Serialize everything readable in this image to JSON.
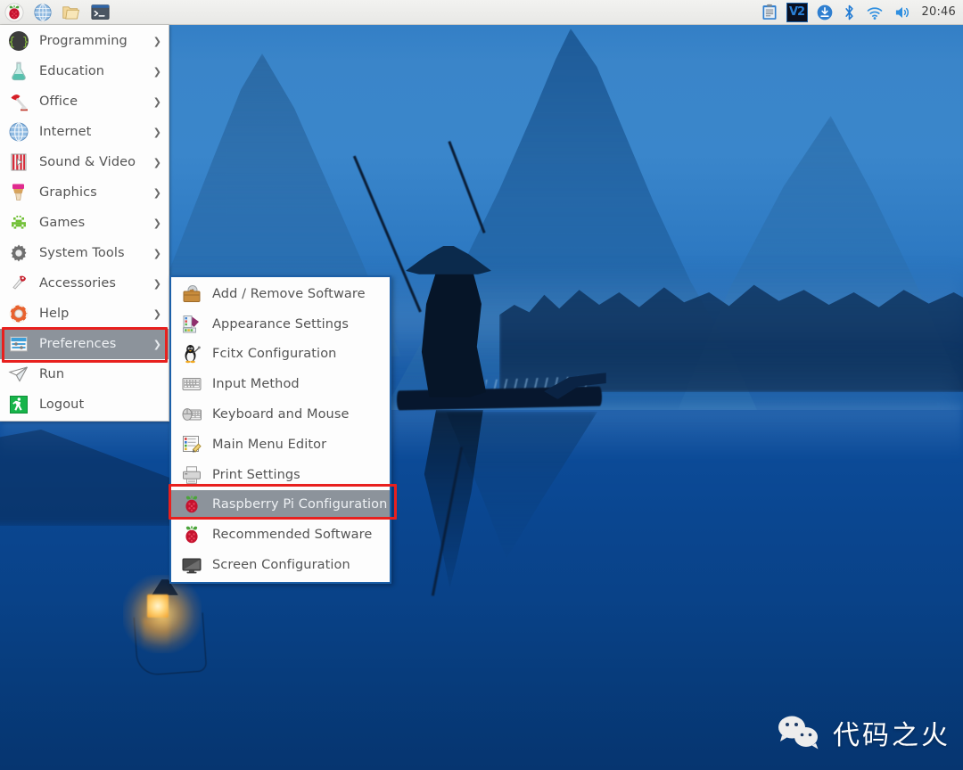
{
  "taskbar": {
    "launchers": [
      {
        "name": "raspberry-menu-icon",
        "label": "Menu"
      },
      {
        "name": "web-browser-icon",
        "label": "Web Browser"
      },
      {
        "name": "file-manager-icon",
        "label": "File Manager"
      },
      {
        "name": "terminal-icon",
        "label": "Terminal"
      }
    ],
    "tray": [
      {
        "name": "clipboard-icon",
        "label": "Clipboard"
      },
      {
        "name": "v2ray-icon",
        "label": "V2"
      },
      {
        "name": "updater-icon",
        "label": "Updates"
      },
      {
        "name": "bluetooth-icon",
        "label": "Bluetooth"
      },
      {
        "name": "wifi-icon",
        "label": "Wireless Network"
      },
      {
        "name": "volume-icon",
        "label": "Volume"
      }
    ],
    "clock": "20:46"
  },
  "main_menu": {
    "items": [
      {
        "label": "Programming",
        "icon": "braces-icon",
        "has_arrow": true,
        "selected": false
      },
      {
        "label": "Education",
        "icon": "flask-icon",
        "has_arrow": true,
        "selected": false
      },
      {
        "label": "Office",
        "icon": "desk-lamp-icon",
        "has_arrow": true,
        "selected": false
      },
      {
        "label": "Internet",
        "icon": "globe-icon",
        "has_arrow": true,
        "selected": false
      },
      {
        "label": "Sound & Video",
        "icon": "film-icon",
        "has_arrow": true,
        "selected": false
      },
      {
        "label": "Graphics",
        "icon": "paintbrush-icon",
        "has_arrow": true,
        "selected": false
      },
      {
        "label": "Games",
        "icon": "space-invader-icon",
        "has_arrow": true,
        "selected": false
      },
      {
        "label": "System Tools",
        "icon": "gear-icon",
        "has_arrow": true,
        "selected": false
      },
      {
        "label": "Accessories",
        "icon": "swiss-knife-icon",
        "has_arrow": true,
        "selected": false
      },
      {
        "label": "Help",
        "icon": "lifebuoy-icon",
        "has_arrow": true,
        "selected": false
      },
      {
        "label": "Preferences",
        "icon": "sliders-icon",
        "has_arrow": true,
        "selected": true
      },
      {
        "label": "Run",
        "icon": "paper-plane-icon",
        "has_arrow": false,
        "selected": false
      },
      {
        "label": "Logout",
        "icon": "exit-run-icon",
        "has_arrow": false,
        "selected": false
      }
    ]
  },
  "submenu": {
    "parent": "Preferences",
    "items": [
      {
        "label": "Add / Remove Software",
        "icon": "package-icon",
        "selected": false
      },
      {
        "label": "Appearance Settings",
        "icon": "palette-icon",
        "selected": false
      },
      {
        "label": "Fcitx Configuration",
        "icon": "penguin-icon",
        "selected": false
      },
      {
        "label": "Input Method",
        "icon": "keyboard-icon",
        "selected": false
      },
      {
        "label": "Keyboard and Mouse",
        "icon": "mouse-keyboard-icon",
        "selected": false
      },
      {
        "label": "Main Menu Editor",
        "icon": "menu-edit-icon",
        "selected": false
      },
      {
        "label": "Print Settings",
        "icon": "printer-icon",
        "selected": false
      },
      {
        "label": "Raspberry Pi Configuration",
        "icon": "raspberry-icon",
        "selected": true
      },
      {
        "label": "Recommended Software",
        "icon": "raspberry-icon",
        "selected": false
      },
      {
        "label": "Screen Configuration",
        "icon": "monitor-icon",
        "selected": false
      }
    ]
  },
  "annotations": [
    {
      "name": "preferences-highlight",
      "target": "Preferences",
      "color": "#e8201e"
    },
    {
      "name": "raspberry-pi-configuration-highlight",
      "target": "Raspberry Pi Configuration",
      "color": "#e8201e"
    }
  ],
  "watermark": {
    "text": "代码之火",
    "icon": "wechat-icon"
  },
  "colors": {
    "taskbar_bg": "#ebebe9",
    "menu_bg": "#fdfdfd",
    "menu_text": "#545454",
    "selection_bg": "#8c939b",
    "submenu_border": "#1b5fa8",
    "annotation_red": "#e8201e",
    "desktop_blue": "#0d4f9e"
  }
}
